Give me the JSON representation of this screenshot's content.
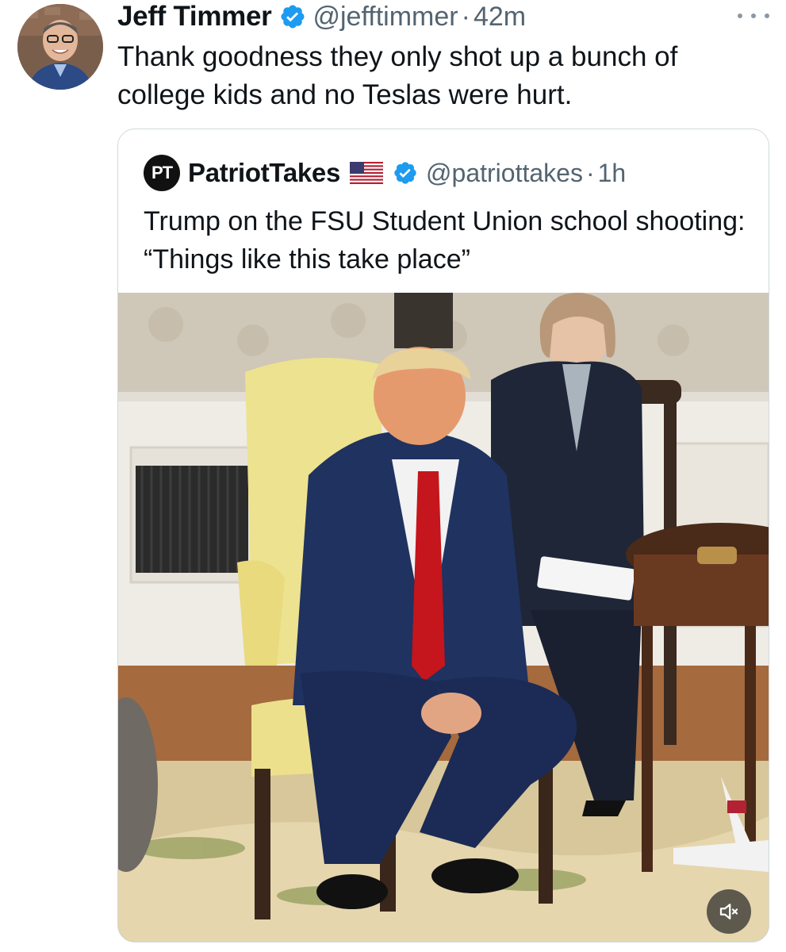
{
  "tweet": {
    "author_name": "Jeff Timmer",
    "author_handle": "@jefftimmer",
    "separator": "·",
    "time": "42m",
    "text": "Thank goodness they only shot up a bunch of college kids and no Teslas were hurt.",
    "avatar_icon": "user-photo-avatar",
    "more_icon": "more-options-icon"
  },
  "quoted_tweet": {
    "logo_text": "PT",
    "author_name": "PatriotTakes",
    "flag_icon": "us-flag-icon",
    "author_handle": "@patriottakes",
    "separator": "·",
    "time": "1h",
    "text": "Trump on the FSU Student Union school shooting: “Things like this take place”",
    "media": {
      "type": "video",
      "mute_icon": "muted-speaker-icon"
    }
  },
  "colors": {
    "verified_blue": "#1d9bf0",
    "secondary_text": "#536471",
    "border": "#cfd9de"
  }
}
